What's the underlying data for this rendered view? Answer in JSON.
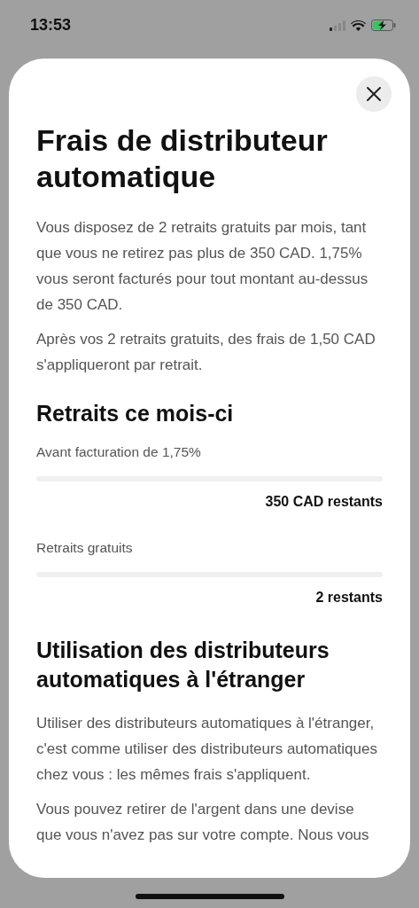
{
  "status_bar": {
    "time": "13:53"
  },
  "sheet": {
    "title": "Frais de distributeur automatique",
    "intro": [
      "Vous disposez de 2 retraits gratuits par mois, tant que vous ne retirez pas plus de 350 CAD. 1,75% vous seront facturés pour tout montant au-dessus de 350 CAD.",
      "Après vos 2 retraits gratuits, des frais de 1,50 CAD s'appliqueront par retrait."
    ],
    "usage_heading": "Retraits ce mois-ci",
    "meters": [
      {
        "label": "Avant facturation de 1,75%",
        "reading": "350 CAD restants"
      },
      {
        "label": "Retraits gratuits",
        "reading": "2 restants"
      }
    ],
    "abroad_heading": "Utilisation des distributeurs automatiques à l'étranger",
    "abroad_text": [
      "Utiliser des distributeurs automatiques à l'étranger, c'est comme utiliser des distributeurs automatiques chez vous : les mêmes frais s'appliquent.",
      "Vous pouvez retirer de l'argent dans une devise que vous n'avez pas sur votre compte. Nous vous"
    ]
  }
}
